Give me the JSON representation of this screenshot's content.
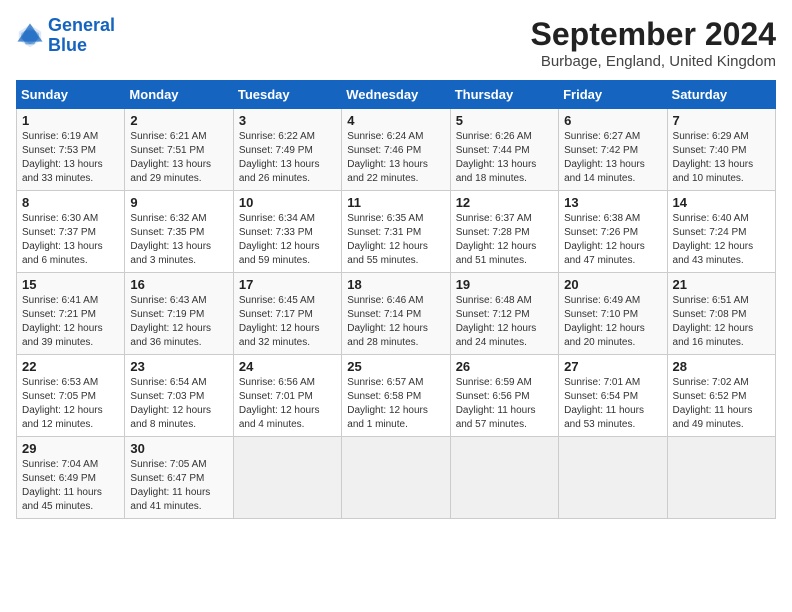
{
  "header": {
    "logo_line1": "General",
    "logo_line2": "Blue",
    "month_title": "September 2024",
    "location": "Burbage, England, United Kingdom"
  },
  "weekdays": [
    "Sunday",
    "Monday",
    "Tuesday",
    "Wednesday",
    "Thursday",
    "Friday",
    "Saturday"
  ],
  "weeks": [
    [
      {
        "day": "1",
        "sunrise": "Sunrise: 6:19 AM",
        "sunset": "Sunset: 7:53 PM",
        "daylight": "Daylight: 13 hours and 33 minutes."
      },
      {
        "day": "2",
        "sunrise": "Sunrise: 6:21 AM",
        "sunset": "Sunset: 7:51 PM",
        "daylight": "Daylight: 13 hours and 29 minutes."
      },
      {
        "day": "3",
        "sunrise": "Sunrise: 6:22 AM",
        "sunset": "Sunset: 7:49 PM",
        "daylight": "Daylight: 13 hours and 26 minutes."
      },
      {
        "day": "4",
        "sunrise": "Sunrise: 6:24 AM",
        "sunset": "Sunset: 7:46 PM",
        "daylight": "Daylight: 13 hours and 22 minutes."
      },
      {
        "day": "5",
        "sunrise": "Sunrise: 6:26 AM",
        "sunset": "Sunset: 7:44 PM",
        "daylight": "Daylight: 13 hours and 18 minutes."
      },
      {
        "day": "6",
        "sunrise": "Sunrise: 6:27 AM",
        "sunset": "Sunset: 7:42 PM",
        "daylight": "Daylight: 13 hours and 14 minutes."
      },
      {
        "day": "7",
        "sunrise": "Sunrise: 6:29 AM",
        "sunset": "Sunset: 7:40 PM",
        "daylight": "Daylight: 13 hours and 10 minutes."
      }
    ],
    [
      {
        "day": "8",
        "sunrise": "Sunrise: 6:30 AM",
        "sunset": "Sunset: 7:37 PM",
        "daylight": "Daylight: 13 hours and 6 minutes."
      },
      {
        "day": "9",
        "sunrise": "Sunrise: 6:32 AM",
        "sunset": "Sunset: 7:35 PM",
        "daylight": "Daylight: 13 hours and 3 minutes."
      },
      {
        "day": "10",
        "sunrise": "Sunrise: 6:34 AM",
        "sunset": "Sunset: 7:33 PM",
        "daylight": "Daylight: 12 hours and 59 minutes."
      },
      {
        "day": "11",
        "sunrise": "Sunrise: 6:35 AM",
        "sunset": "Sunset: 7:31 PM",
        "daylight": "Daylight: 12 hours and 55 minutes."
      },
      {
        "day": "12",
        "sunrise": "Sunrise: 6:37 AM",
        "sunset": "Sunset: 7:28 PM",
        "daylight": "Daylight: 12 hours and 51 minutes."
      },
      {
        "day": "13",
        "sunrise": "Sunrise: 6:38 AM",
        "sunset": "Sunset: 7:26 PM",
        "daylight": "Daylight: 12 hours and 47 minutes."
      },
      {
        "day": "14",
        "sunrise": "Sunrise: 6:40 AM",
        "sunset": "Sunset: 7:24 PM",
        "daylight": "Daylight: 12 hours and 43 minutes."
      }
    ],
    [
      {
        "day": "15",
        "sunrise": "Sunrise: 6:41 AM",
        "sunset": "Sunset: 7:21 PM",
        "daylight": "Daylight: 12 hours and 39 minutes."
      },
      {
        "day": "16",
        "sunrise": "Sunrise: 6:43 AM",
        "sunset": "Sunset: 7:19 PM",
        "daylight": "Daylight: 12 hours and 36 minutes."
      },
      {
        "day": "17",
        "sunrise": "Sunrise: 6:45 AM",
        "sunset": "Sunset: 7:17 PM",
        "daylight": "Daylight: 12 hours and 32 minutes."
      },
      {
        "day": "18",
        "sunrise": "Sunrise: 6:46 AM",
        "sunset": "Sunset: 7:14 PM",
        "daylight": "Daylight: 12 hours and 28 minutes."
      },
      {
        "day": "19",
        "sunrise": "Sunrise: 6:48 AM",
        "sunset": "Sunset: 7:12 PM",
        "daylight": "Daylight: 12 hours and 24 minutes."
      },
      {
        "day": "20",
        "sunrise": "Sunrise: 6:49 AM",
        "sunset": "Sunset: 7:10 PM",
        "daylight": "Daylight: 12 hours and 20 minutes."
      },
      {
        "day": "21",
        "sunrise": "Sunrise: 6:51 AM",
        "sunset": "Sunset: 7:08 PM",
        "daylight": "Daylight: 12 hours and 16 minutes."
      }
    ],
    [
      {
        "day": "22",
        "sunrise": "Sunrise: 6:53 AM",
        "sunset": "Sunset: 7:05 PM",
        "daylight": "Daylight: 12 hours and 12 minutes."
      },
      {
        "day": "23",
        "sunrise": "Sunrise: 6:54 AM",
        "sunset": "Sunset: 7:03 PM",
        "daylight": "Daylight: 12 hours and 8 minutes."
      },
      {
        "day": "24",
        "sunrise": "Sunrise: 6:56 AM",
        "sunset": "Sunset: 7:01 PM",
        "daylight": "Daylight: 12 hours and 4 minutes."
      },
      {
        "day": "25",
        "sunrise": "Sunrise: 6:57 AM",
        "sunset": "Sunset: 6:58 PM",
        "daylight": "Daylight: 12 hours and 1 minute."
      },
      {
        "day": "26",
        "sunrise": "Sunrise: 6:59 AM",
        "sunset": "Sunset: 6:56 PM",
        "daylight": "Daylight: 11 hours and 57 minutes."
      },
      {
        "day": "27",
        "sunrise": "Sunrise: 7:01 AM",
        "sunset": "Sunset: 6:54 PM",
        "daylight": "Daylight: 11 hours and 53 minutes."
      },
      {
        "day": "28",
        "sunrise": "Sunrise: 7:02 AM",
        "sunset": "Sunset: 6:52 PM",
        "daylight": "Daylight: 11 hours and 49 minutes."
      }
    ],
    [
      {
        "day": "29",
        "sunrise": "Sunrise: 7:04 AM",
        "sunset": "Sunset: 6:49 PM",
        "daylight": "Daylight: 11 hours and 45 minutes."
      },
      {
        "day": "30",
        "sunrise": "Sunrise: 7:05 AM",
        "sunset": "Sunset: 6:47 PM",
        "daylight": "Daylight: 11 hours and 41 minutes."
      },
      null,
      null,
      null,
      null,
      null
    ]
  ]
}
